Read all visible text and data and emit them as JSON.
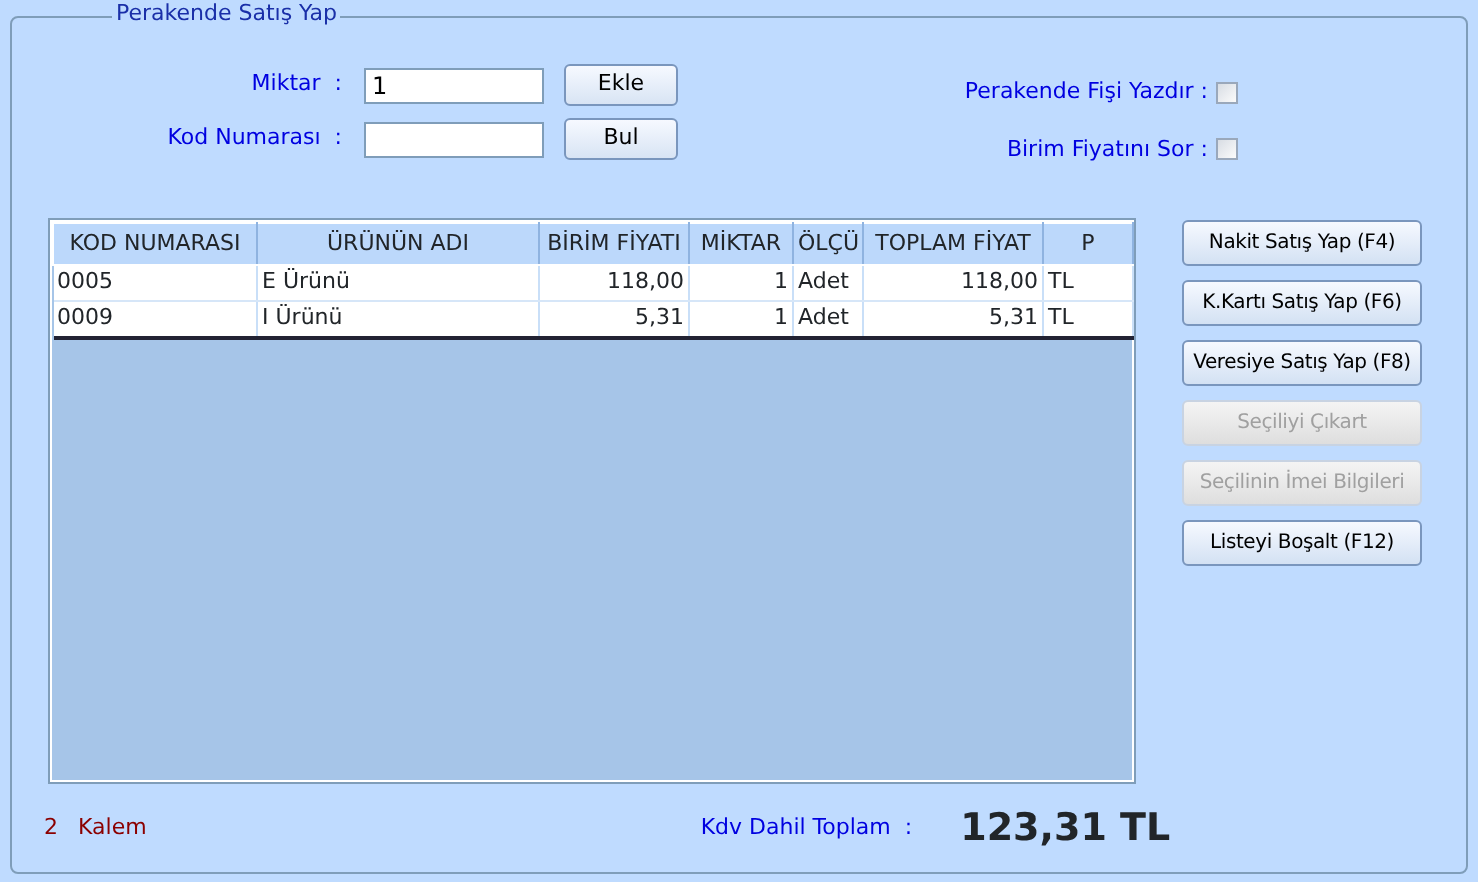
{
  "panel": {
    "title": "Perakende Satış Yap"
  },
  "fields": [
    {
      "label": "Miktar  :",
      "value": "1",
      "button": "Ekle"
    },
    {
      "label": "Kod Numarası  :",
      "button": "Bul"
    }
  ],
  "options": [
    {
      "label": "Perakende Fişi Yazdır :",
      "checked": false
    },
    {
      "label": "Birim Fiyatını Sor :",
      "checked": false
    }
  ],
  "table": {
    "columns": [
      "KOD NUMARASI",
      "ÜRÜNÜN ADI",
      "BİRİM FİYATI",
      "MİKTAR",
      "ÖLÇÜ",
      "TOPLAM FİYAT",
      "P"
    ],
    "rows": [
      [
        "0005",
        "E Ürünü",
        "118,00",
        "1",
        "Adet",
        "118,00",
        "TL"
      ],
      [
        "0009",
        "I Ürünü",
        "5,31",
        "1",
        "Adet",
        "5,31",
        "TL"
      ]
    ]
  },
  "actions": [
    {
      "label": "Nakit Satış Yap (F4)",
      "disabled": false
    },
    {
      "label": "K.Kartı Satış Yap (F6)",
      "disabled": false
    },
    {
      "label": "Veresiye Satış Yap (F8)",
      "disabled": false
    },
    {
      "label": "Seçiliyi Çıkart",
      "disabled": true
    },
    {
      "label": "Seçilinin İmei Bilgileri",
      "disabled": true
    },
    {
      "label": "Listeyi Boşalt (F12)",
      "disabled": false
    }
  ],
  "footer": {
    "count": "2",
    "count_label": "Kalem",
    "total_label": "Kdv Dahil Toplam  :",
    "total": "123,31 TL"
  }
}
